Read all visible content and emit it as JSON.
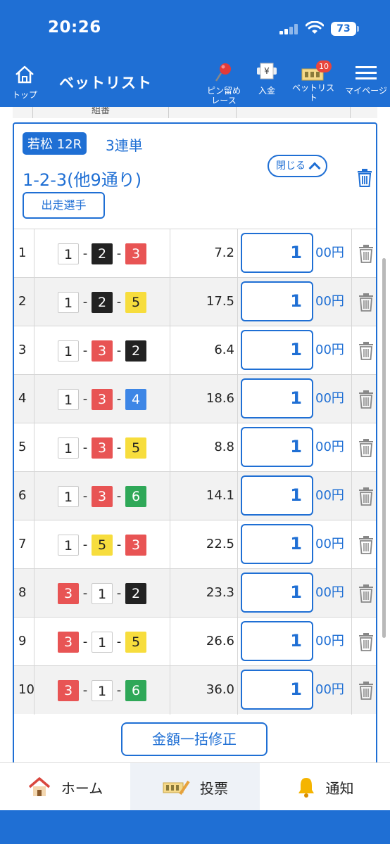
{
  "status": {
    "time": "20:26",
    "battery": "73"
  },
  "header": {
    "home_label": "トップ",
    "title": "ベットリスト",
    "pin_label_1": "ピン留め",
    "pin_label_2": "レース",
    "deposit_label": "入金",
    "betlist_label": "ベットリスト",
    "betlist_badge": "10",
    "mypage_label": "マイページ"
  },
  "table_header": {
    "combo": "組番"
  },
  "race": {
    "venue_race": "若松 12R",
    "bet_type": "3連単",
    "combo_summary": "1-2-3(他9通り)",
    "close_label": "閉じる",
    "runners_label": "出走選手"
  },
  "bets": [
    {
      "no": "1",
      "c1": "1",
      "c2": "2",
      "c3": "3",
      "odds": "7.2",
      "amount": "1",
      "unit": "00円"
    },
    {
      "no": "2",
      "c1": "1",
      "c2": "2",
      "c3": "5",
      "odds": "17.5",
      "amount": "1",
      "unit": "00円"
    },
    {
      "no": "3",
      "c1": "1",
      "c2": "3",
      "c3": "2",
      "odds": "6.4",
      "amount": "1",
      "unit": "00円"
    },
    {
      "no": "4",
      "c1": "1",
      "c2": "3",
      "c3": "4",
      "odds": "18.6",
      "amount": "1",
      "unit": "00円"
    },
    {
      "no": "5",
      "c1": "1",
      "c2": "3",
      "c3": "5",
      "odds": "8.8",
      "amount": "1",
      "unit": "00円"
    },
    {
      "no": "6",
      "c1": "1",
      "c2": "3",
      "c3": "6",
      "odds": "14.1",
      "amount": "1",
      "unit": "00円"
    },
    {
      "no": "7",
      "c1": "1",
      "c2": "5",
      "c3": "3",
      "odds": "22.5",
      "amount": "1",
      "unit": "00円"
    },
    {
      "no": "8",
      "c1": "3",
      "c2": "1",
      "c3": "2",
      "odds": "23.3",
      "amount": "1",
      "unit": "00円"
    },
    {
      "no": "9",
      "c1": "3",
      "c2": "1",
      "c3": "5",
      "odds": "26.6",
      "amount": "1",
      "unit": "00円"
    },
    {
      "no": "10",
      "c1": "3",
      "c2": "1",
      "c3": "6",
      "odds": "36.0",
      "amount": "1",
      "unit": "00円"
    }
  ],
  "bulk_edit_label": "金額一括修正",
  "tabs": {
    "home": "ホーム",
    "vote": "投票",
    "notify": "通知"
  },
  "colors": {
    "primary": "#1f6fd4",
    "badge": "#e8453c"
  }
}
